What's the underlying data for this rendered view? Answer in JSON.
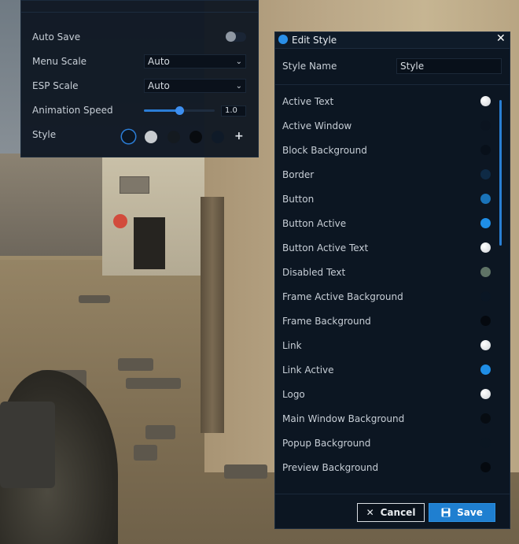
{
  "settings": {
    "auto_save_label": "Auto Save",
    "menu_scale_label": "Menu Scale",
    "menu_scale_value": "Auto",
    "esp_scale_label": "ESP Scale",
    "esp_scale_value": "Auto",
    "animation_speed_label": "Animation Speed",
    "animation_speed_value": "1.0",
    "animation_speed_fraction": 0.5,
    "style_label": "Style",
    "add_label": "+",
    "style_swatches": [
      "#0c1622",
      "#c8ccd0",
      "#141a20",
      "#080b0f",
      "#0f1a28"
    ]
  },
  "dialog": {
    "title": "Edit Style",
    "close_label": "✕",
    "style_name_label": "Style Name",
    "style_name_value": "Style",
    "colors": [
      {
        "label": "Active Text",
        "color": "#e6e8ea"
      },
      {
        "label": "Active Window",
        "color": "#0b1420"
      },
      {
        "label": "Block Background",
        "color": "#08101a"
      },
      {
        "label": "Border",
        "color": "#0e2a45"
      },
      {
        "label": "Button",
        "color": "#1a73b8"
      },
      {
        "label": "Button Active",
        "color": "#1f8ee6"
      },
      {
        "label": "Button Active Text",
        "color": "#e6e8ea"
      },
      {
        "label": "Disabled Text",
        "color": "#5f7366"
      },
      {
        "label": "Frame Active Background",
        "color": "#0a1624"
      },
      {
        "label": "Frame Background",
        "color": "#05090f"
      },
      {
        "label": "Link",
        "color": "#e6e8ea"
      },
      {
        "label": "Link Active",
        "color": "#1f8ee6"
      },
      {
        "label": "Logo",
        "color": "#e6e8ea"
      },
      {
        "label": "Main Window Background",
        "color": "#070c12"
      },
      {
        "label": "Popup Background",
        "color": "#0b1622"
      },
      {
        "label": "Preview Background",
        "color": "#05090f"
      }
    ],
    "cancel_label": "Cancel",
    "save_label": "Save"
  }
}
